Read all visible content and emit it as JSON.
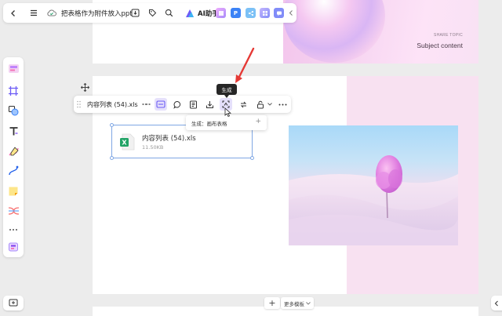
{
  "topbar": {
    "doc_title": "把表格作为附件放入ppt",
    "ai_label": "AI助手",
    "chips": [
      {
        "icon": "doc-chip-icon",
        "letter": "",
        "color": "#c084fc"
      },
      {
        "icon": "p-chip-icon",
        "letter": "P",
        "color": "#3b82f6"
      },
      {
        "icon": "share-chip-icon",
        "letter": "",
        "color": "#60a5fa"
      },
      {
        "icon": "grid-chip-icon",
        "letter": "",
        "color": "#a78bfa"
      },
      {
        "icon": "chat-chip-icon",
        "letter": "",
        "color": "#818cf8"
      }
    ]
  },
  "slide_top": {
    "share_topic": "SHARE TOPIC",
    "subject": "Subject content"
  },
  "selection_toolbar": {
    "file_name": "内容列表 (54).xls",
    "tooltip": "生成"
  },
  "menu": {
    "item": "生成：画布表格",
    "plus": "+"
  },
  "file_card": {
    "name": "内容列表 (54).xls",
    "size": "11.50KB",
    "badge": "X"
  },
  "bottom": {
    "add": "+",
    "more_templates": "更多模板"
  },
  "colors": {
    "accent": "#7c5cf5",
    "selection": "#7fa7e4",
    "arrow": "#e53935",
    "excel": "#21a366"
  }
}
